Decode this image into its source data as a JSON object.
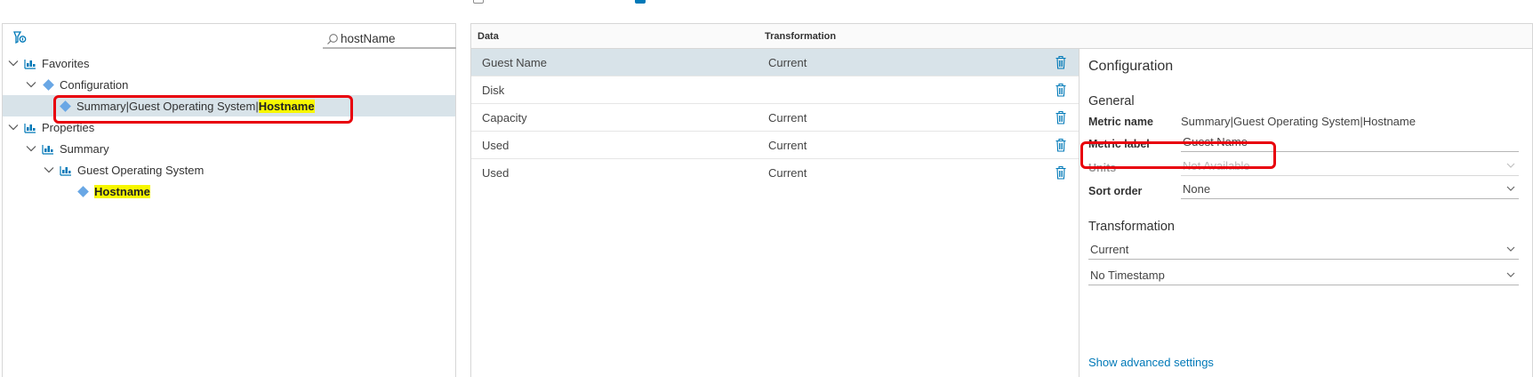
{
  "search": {
    "value": "hostName"
  },
  "tree": {
    "favorites": "Favorites",
    "configuration": "Configuration",
    "selected_item": {
      "prefix": "Summary|Guest Operating System|",
      "highlight": "Hostname"
    },
    "properties": "Properties",
    "summary": "Summary",
    "guest_os": "Guest Operating System",
    "hostname": "Hostname"
  },
  "grid": {
    "headers": {
      "data": "Data",
      "transformation": "Transformation"
    },
    "rows": [
      {
        "data": "Guest Name",
        "transformation": "Current"
      },
      {
        "data": "Disk",
        "transformation": ""
      },
      {
        "data": "Capacity",
        "transformation": "Current"
      },
      {
        "data": "Used",
        "transformation": "Current"
      },
      {
        "data": "Used",
        "transformation": "Current"
      }
    ]
  },
  "config": {
    "title": "Configuration",
    "general": "General",
    "metric_name_label": "Metric name",
    "metric_name_value": "Summary|Guest Operating System|Hostname",
    "metric_label_label": "Metric label",
    "metric_label_value": "Guest Name",
    "units_label": "Units",
    "units_value": "Not Available",
    "sort_order_label": "Sort order",
    "sort_order_value": "None",
    "transformation_heading": "Transformation",
    "transformation_value": "Current",
    "timestamp_value": "No Timestamp",
    "advanced_link": "Show advanced settings"
  },
  "colors": {
    "accent": "#0079b8",
    "selection": "#d8e3e9",
    "highlight": "#f7f700",
    "callout": "#e8000b"
  }
}
